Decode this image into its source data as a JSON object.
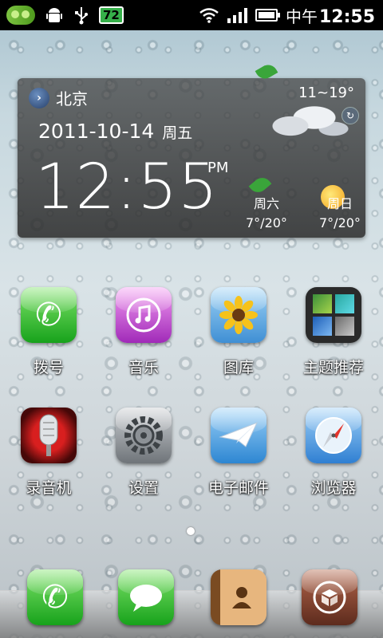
{
  "status_bar": {
    "battery_level": "72",
    "time_prefix": "中午",
    "time": "12:55",
    "icons": [
      "peas-app-icon",
      "android-debug-icon",
      "usb-icon",
      "battery-level-icon",
      "wifi-icon",
      "signal-icon",
      "battery-icon"
    ]
  },
  "weather_widget": {
    "city": "北京",
    "date": "2011-10-14",
    "weekday": "周五",
    "time": "12:55",
    "ampm": "PM",
    "temp_range": "11~19°",
    "forecast": [
      {
        "day": "周六",
        "temp": "7°/20°"
      },
      {
        "day": "周日",
        "temp": "7°/20°"
      }
    ]
  },
  "apps": [
    {
      "label": "拨号",
      "icon": "phone-icon"
    },
    {
      "label": "音乐",
      "icon": "music-icon"
    },
    {
      "label": "图库",
      "icon": "gallery-icon"
    },
    {
      "label": "主题推荐",
      "icon": "theme-icon"
    },
    {
      "label": "录音机",
      "icon": "recorder-icon"
    },
    {
      "label": "设置",
      "icon": "settings-icon"
    },
    {
      "label": "电子邮件",
      "icon": "mail-icon"
    },
    {
      "label": "浏览器",
      "icon": "browser-icon"
    }
  ],
  "dock": [
    "phone-icon",
    "messages-icon",
    "contacts-icon",
    "app-store-icon"
  ],
  "page_indicator": {
    "current": 1
  }
}
